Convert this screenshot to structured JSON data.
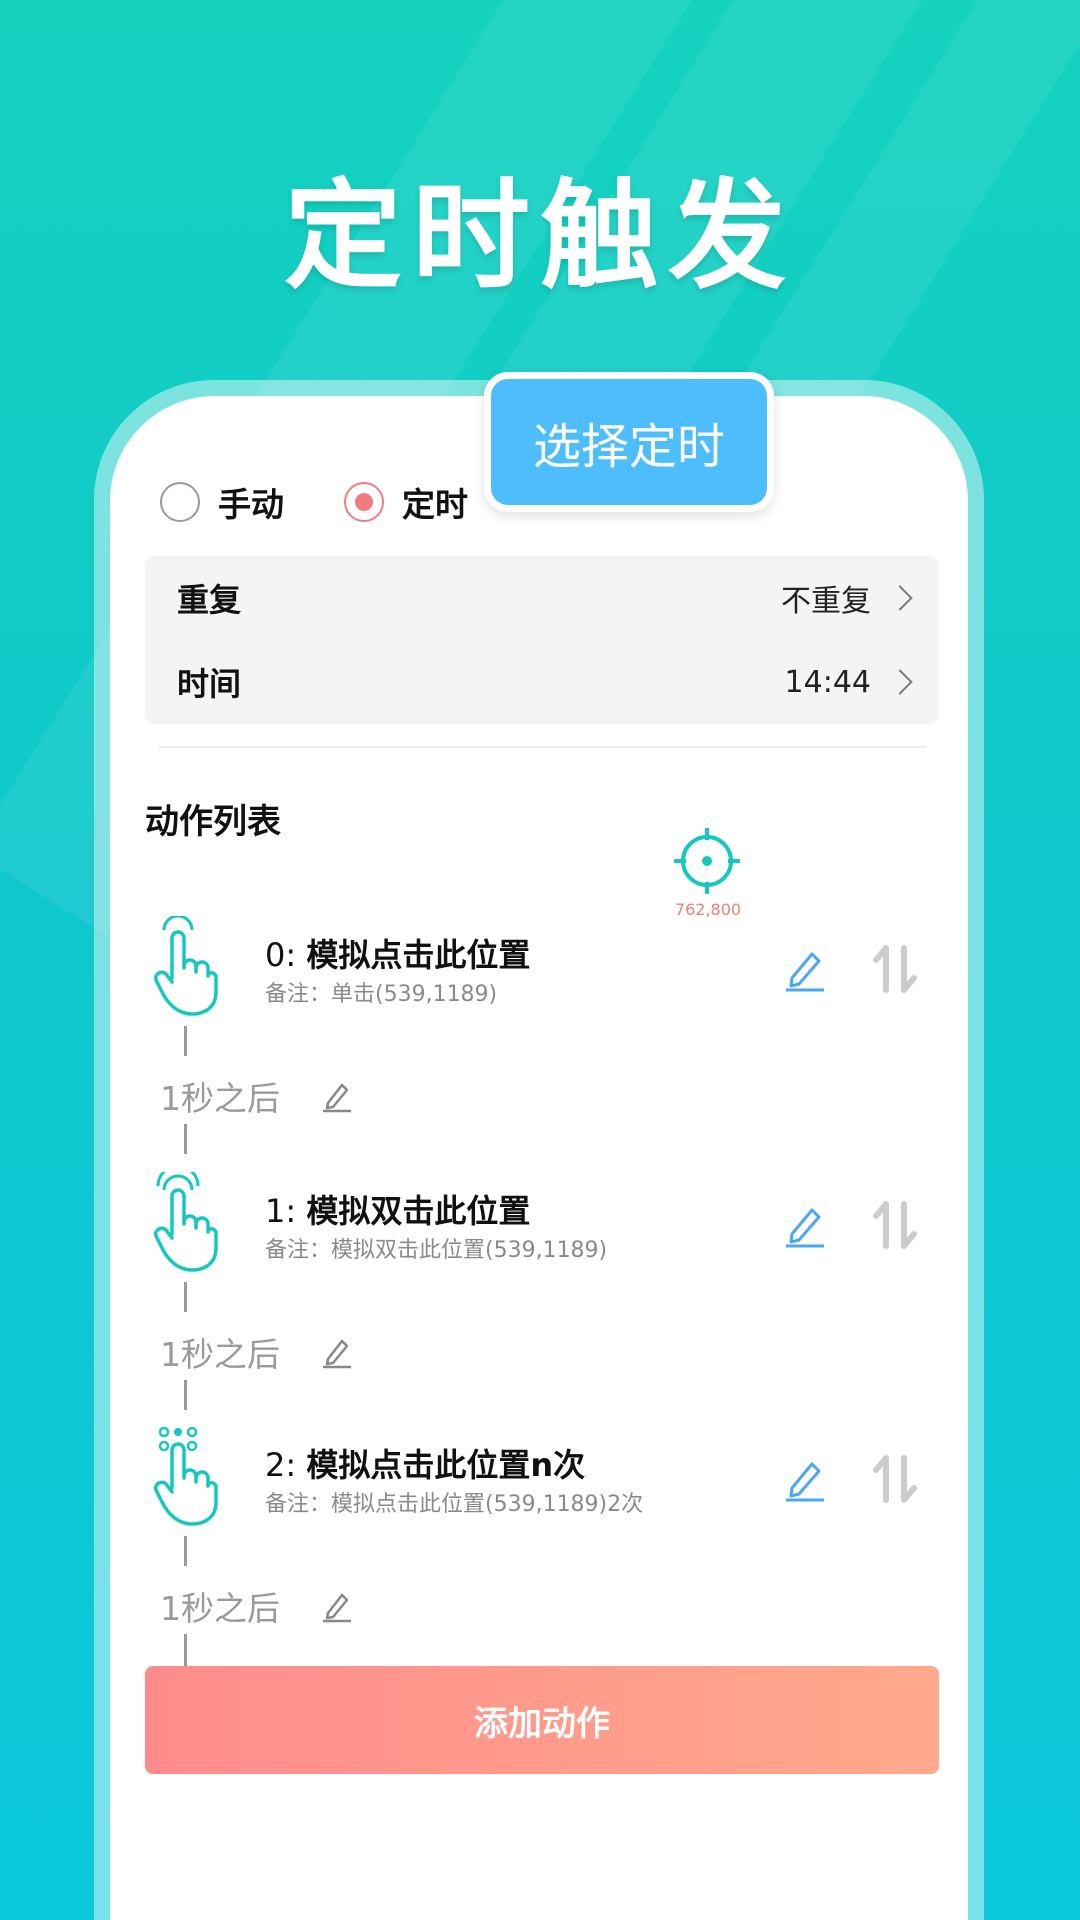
{
  "hero_title": "定时触发",
  "callout_label": "选择定时",
  "mode": {
    "manual_label": "手动",
    "timed_label": "定时",
    "selected": "定时"
  },
  "settings": {
    "repeat_label": "重复",
    "repeat_value": "不重复",
    "time_label": "时间",
    "time_value": "14:44"
  },
  "section_title": "动作列表",
  "target": {
    "coords": "762,800"
  },
  "actions": [
    {
      "index": "0:",
      "title": "模拟点击此位置",
      "note": "备注：单击(539,1189)",
      "icon": "tap-hand-icon"
    },
    {
      "index": "1:",
      "title": "模拟双击此位置",
      "note": "备注：模拟双击此位置(539,1189)",
      "icon": "double-tap-hand-icon"
    },
    {
      "index": "2:",
      "title": "模拟点击此位置n次",
      "note": "备注：模拟点击此位置(539,1189)2次",
      "icon": "multi-tap-hand-icon"
    }
  ],
  "delays": [
    "1秒之后",
    "1秒之后",
    "1秒之后"
  ],
  "add_button_label": "添加动作",
  "colors": {
    "accent_teal": "#14d2be",
    "callout_blue": "#4dbdfc",
    "radio_red": "#f07d7d",
    "edit_blue": "#4aa8f0",
    "button_gradient_start": "#ff8c8c",
    "button_gradient_end": "#ffa98c"
  }
}
